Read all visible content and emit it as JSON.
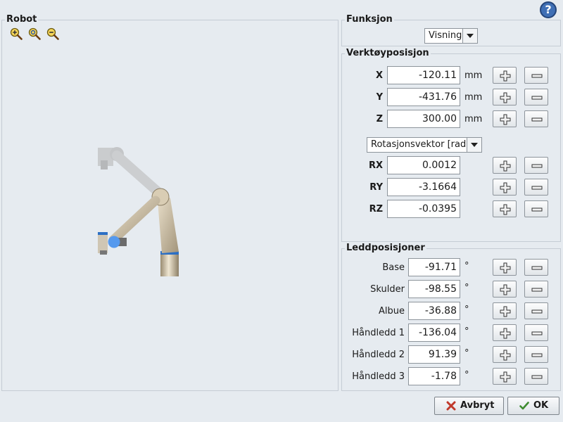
{
  "help": {
    "label": "?"
  },
  "robot_panel": {
    "title": "Robot"
  },
  "function_panel": {
    "title": "Funksjon",
    "selected": "Visning"
  },
  "tool_position": {
    "title": "Verktøyposisjon",
    "unit": "mm",
    "axes": [
      {
        "label": "X",
        "value": "-120.11"
      },
      {
        "label": "Y",
        "value": "-431.76"
      },
      {
        "label": "Z",
        "value": "300.00"
      }
    ],
    "rotation_mode": "Rotasjonsvektor [rad]",
    "rotations": [
      {
        "label": "RX",
        "value": "0.0012"
      },
      {
        "label": "RY",
        "value": "-3.1664"
      },
      {
        "label": "RZ",
        "value": "-0.0395"
      }
    ]
  },
  "joint_positions": {
    "title": "Leddposisjoner",
    "unit": "°",
    "joints": [
      {
        "label": "Base",
        "value": "-91.71"
      },
      {
        "label": "Skulder",
        "value": "-98.55"
      },
      {
        "label": "Albue",
        "value": "-36.88"
      },
      {
        "label": "Håndledd 1",
        "value": "-136.04"
      },
      {
        "label": "Håndledd 2",
        "value": "91.39"
      },
      {
        "label": "Håndledd 3",
        "value": "-1.78"
      }
    ]
  },
  "buttons": {
    "cancel": "Avbryt",
    "ok": "OK"
  },
  "colors": {
    "accent": "#3f6fb5",
    "cancel_icon": "#c0392b",
    "ok_icon": "#3d8b2f",
    "tcp_marker": "#5599ee"
  }
}
